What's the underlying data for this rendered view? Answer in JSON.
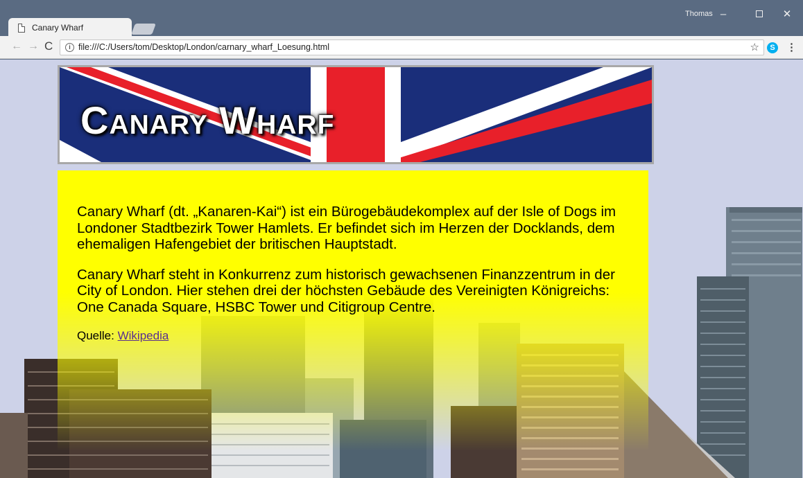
{
  "browser": {
    "tab_title": "Canary Wharf",
    "tab_close": "×",
    "user_name": "Thomas",
    "url": "file:///C:/Users/tom/Desktop/London/carnary_wharf_Loesung.html",
    "controls": {
      "minimize": "–",
      "close": "✕",
      "back": "←",
      "forward": "→",
      "reload": "C",
      "star": "☆",
      "menu": "⋮",
      "info": "i",
      "skype": "S"
    }
  },
  "page": {
    "banner_title": "Canary Wharf",
    "paragraphs": [
      "Canary Wharf (dt. „Kanaren-Kai“) ist ein Bürogebäudekomplex auf der Isle of Dogs im Londoner Stadtbezirk Tower Hamlets. Er befindet sich im Herzen der Docklands, dem ehemaligen Hafengebiet der britischen Hauptstadt.",
      "Canary Wharf steht in Konkurrenz zum historisch gewachsenen Finanzzentrum in der City of London. Hier stehen drei der höchsten Gebäude des Vereinigten Königreichs: One Canada Square, HSBC Tower und Citigroup Centre."
    ],
    "source_label": "Quelle:",
    "source_link": "Wikipedia"
  },
  "colors": {
    "window_frame": "#5a6b82",
    "page_background": "#cdd2e8",
    "content_background": "#ffff00",
    "link": "#5a2f8e",
    "flag_blue": "#1a2e7a",
    "flag_red": "#e8202a"
  }
}
